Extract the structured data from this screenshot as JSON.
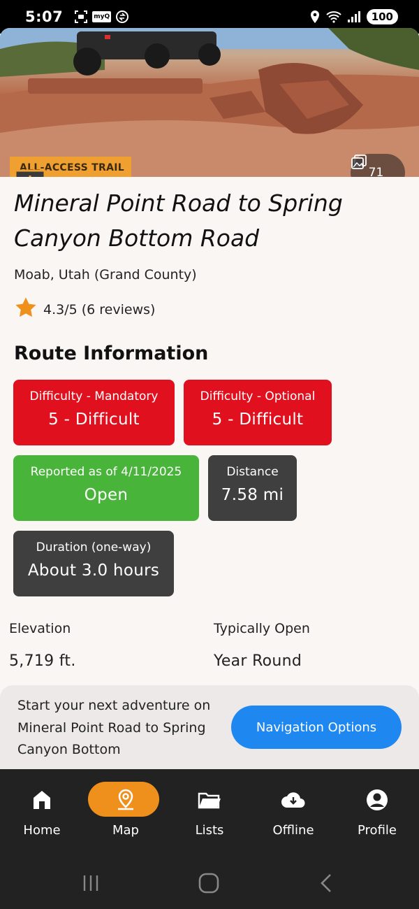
{
  "status_bar": {
    "time": "5:07",
    "myq_label": "myQ",
    "battery": "100"
  },
  "hero": {
    "badge_label": "ALL-ACCESS TRAIL",
    "photo_count": "71"
  },
  "trail": {
    "title": "Mineral Point Road to Spring Canyon Bottom Road",
    "location": "Moab, Utah (Grand County)",
    "rating": "4.3/5 (6 reviews)"
  },
  "route_info": {
    "heading": "Route Information",
    "difficulty_mandatory": {
      "label": "Difficulty - Mandatory",
      "value": "5 - Difficult"
    },
    "difficulty_optional": {
      "label": "Difficulty - Optional",
      "value": "5 - Difficult"
    },
    "status": {
      "label": "Reported as of 4/11/2025",
      "value": "Open"
    },
    "distance": {
      "label": "Distance",
      "value": "7.58 mi"
    },
    "duration": {
      "label": "Duration (one-way)",
      "value": "About 3.0 hours"
    },
    "elevation": {
      "label": "Elevation",
      "value": "5,719 ft."
    },
    "typically_open": {
      "label": "Typically Open",
      "value": "Year Round"
    }
  },
  "nav_prompt": {
    "text": "Start your next adventure on Mineral Point Road to Spring Canyon Bottom",
    "button_label": "Navigation Options"
  },
  "tabs": [
    {
      "label": "Home",
      "icon": "home-icon"
    },
    {
      "label": "Map",
      "icon": "map-pin-icon",
      "active": true
    },
    {
      "label": "Lists",
      "icon": "folder-icon"
    },
    {
      "label": "Offline",
      "icon": "cloud-download-icon"
    },
    {
      "label": "Profile",
      "icon": "profile-icon"
    }
  ],
  "colors": {
    "difficult_red": "#e0101e",
    "open_green": "#48b53a",
    "neutral_card": "#3f3f3f",
    "accent_orange": "#f0901c",
    "nav_button_blue": "#1e88f0"
  }
}
